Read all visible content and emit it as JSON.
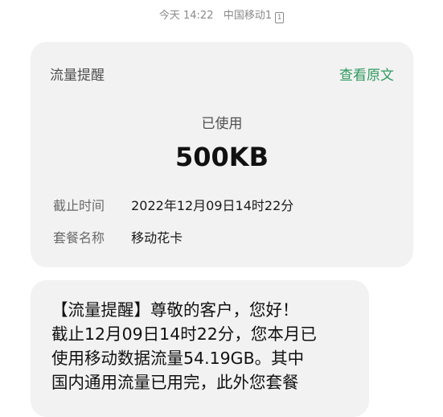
{
  "status_bar": {
    "day": "今天",
    "time": "14:22",
    "carrier": "中国移动1",
    "sim_icon": "sim-card-icon"
  },
  "notification_card": {
    "title": "流量提醒",
    "view_original": "查看原文",
    "used_label": "已使用",
    "used_value": "500KB",
    "deadline_label": "截止时间",
    "deadline_value": "2022年12月09日14时22分",
    "plan_label": "套餐名称",
    "plan_value": "移动花卡"
  },
  "message": {
    "text": "【流量提醒】尊敬的客户，您好！\n截止12月09日14时22分，您本月已\n使用移动数据流量54.19GB。其中\n国内通用流量已用完，此外您套餐"
  },
  "colors": {
    "link": "#2f9a5f",
    "card_bg": "#f2f2f2"
  }
}
